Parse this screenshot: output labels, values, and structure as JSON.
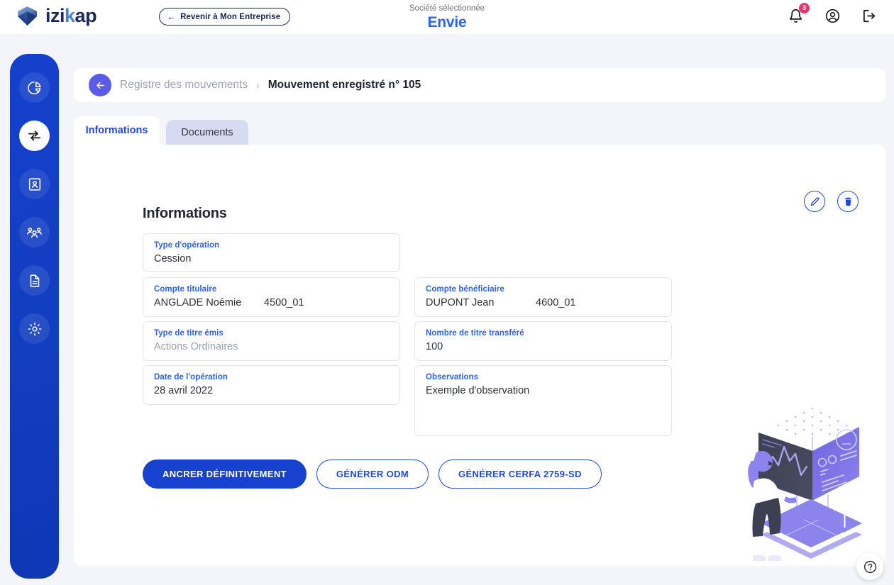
{
  "header": {
    "logo_text_parts": [
      "izi",
      "k",
      "ap"
    ],
    "logo_icon": "izikap-diamond-logo",
    "back_to_company_label": "Revenir à Mon Entreprise",
    "company_label": "Société sélectionnée",
    "company_name": "Envie",
    "notifications_count": "3",
    "icons": [
      "bell-icon",
      "account-circle-icon",
      "logout-icon"
    ]
  },
  "sidebar": {
    "items": [
      {
        "name": "dashboard",
        "icon": "pie-chart-icon",
        "active": false
      },
      {
        "name": "movements",
        "icon": "transfer-arrows-icon",
        "active": true
      },
      {
        "name": "accounts",
        "icon": "id-card-icon",
        "active": false
      },
      {
        "name": "shareholders",
        "icon": "people-group-icon",
        "active": false
      },
      {
        "name": "documents",
        "icon": "document-icon",
        "active": false
      },
      {
        "name": "settings",
        "icon": "gear-icon",
        "active": false
      }
    ]
  },
  "breadcrumb": {
    "back_icon": "arrow-left-icon",
    "previous": "Registre des mouvements",
    "separator": "›",
    "current": "Mouvement enregistré n° 105"
  },
  "tabs": [
    {
      "label": "Informations",
      "active": true
    },
    {
      "label": "Documents",
      "active": false
    }
  ],
  "panel": {
    "title": "Informations",
    "edit_icon": "pencil-icon",
    "delete_icon": "trash-icon",
    "fields": {
      "operation_type": {
        "label": "Type d'opération",
        "value": "Cession"
      },
      "holder_account": {
        "label": "Compte titulaire",
        "value": "ANGLADE Noémie",
        "value2": "4500_01"
      },
      "beneficiary_account": {
        "label": "Compte bénéficiaire",
        "value": "DUPONT Jean",
        "value2": "4600_01"
      },
      "security_type": {
        "label": "Type de titre émis",
        "value": "Actions Ordinaires"
      },
      "transferred_count": {
        "label": "Nombre de titre transféré",
        "value": "100"
      },
      "operation_date": {
        "label": "Date de l'opération",
        "value": "28 avril 2022"
      },
      "observations": {
        "label": "Observations",
        "value": "Exemple d'observation"
      }
    },
    "buttons": {
      "anchor": "ANCRER DÉFINITIVEMENT",
      "generate_odm": "GÉNÉRER ODM",
      "generate_cerfa": "GÉNÉRER CERFA 2759-SD"
    },
    "illustration": "isometric-data-analysis-illustration"
  },
  "help": {
    "icon": "question-mark-icon"
  },
  "colors": {
    "brand_blue": "#1742cf",
    "link_blue": "#2962f6",
    "sidebar_blue": "#1540cd",
    "badge_pink": "#e8356d",
    "back_purple": "#5a5ce8",
    "page_bg": "#f4f5fa"
  }
}
